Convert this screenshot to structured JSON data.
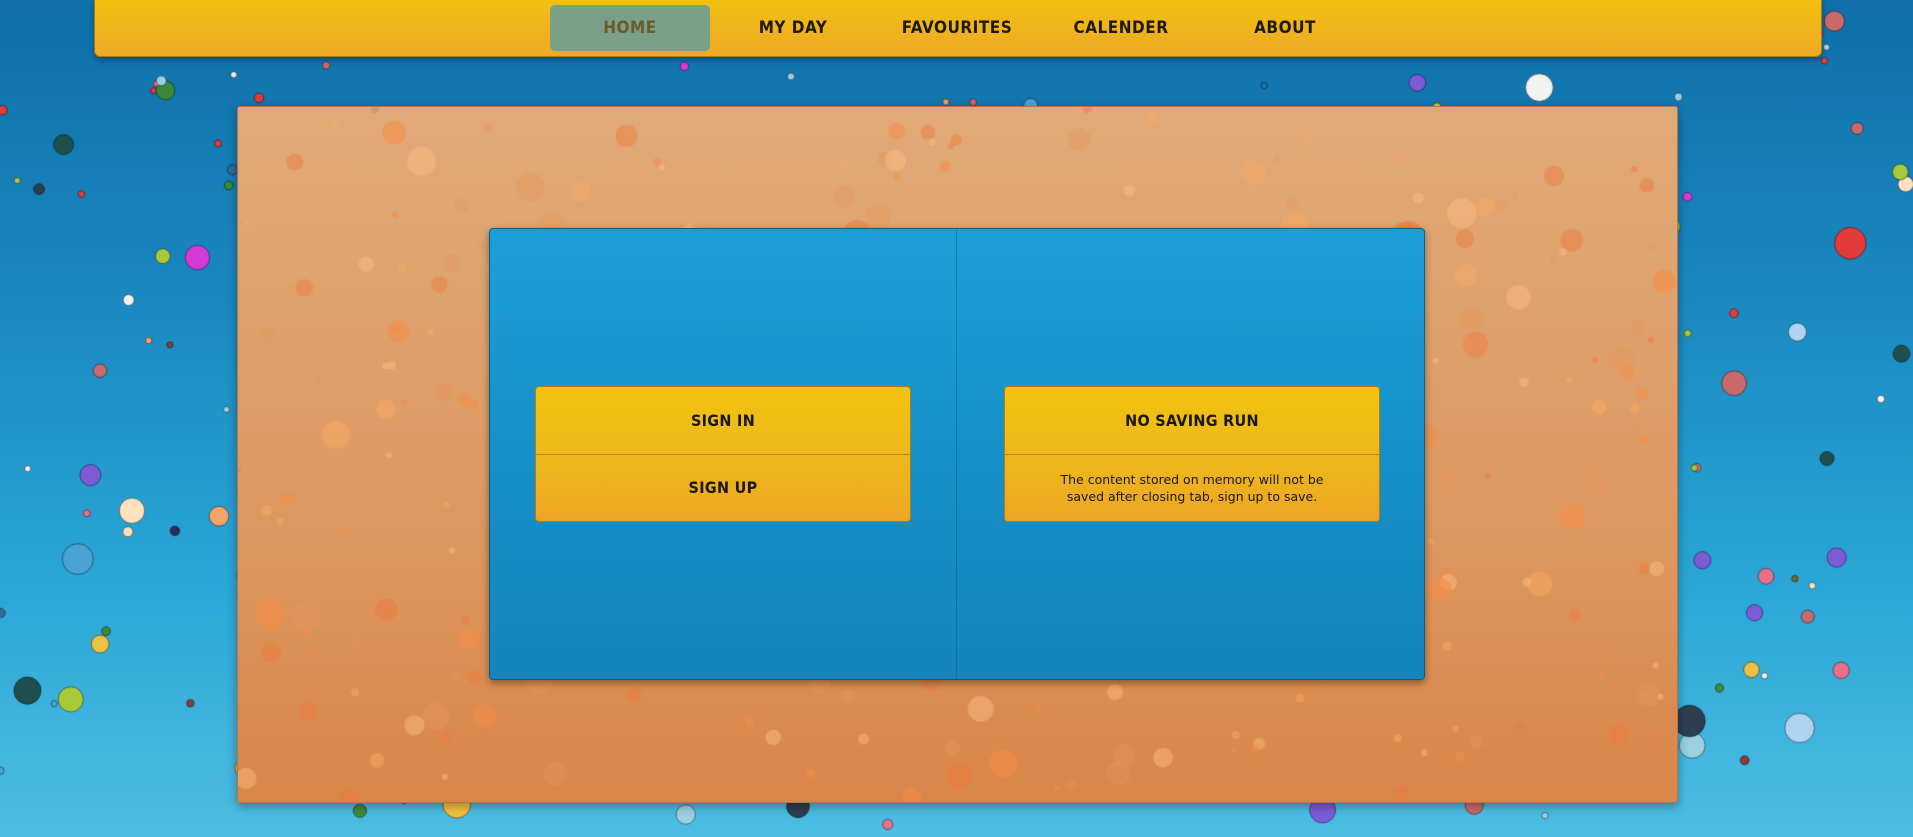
{
  "nav": {
    "items": [
      {
        "label": "HOME",
        "active": true
      },
      {
        "label": "MY DAY",
        "active": false
      },
      {
        "label": "FAVOURITES",
        "active": false
      },
      {
        "label": "CALENDER",
        "active": false
      },
      {
        "label": "ABOUT",
        "active": false
      }
    ]
  },
  "left_panel": {
    "sign_in_label": "SIGN IN",
    "sign_up_label": "SIGN UP"
  },
  "right_panel": {
    "no_saving_label": "NO SAVING RUN",
    "info_text": "The content stored on memory will not be saved after closing tab, sign up to save."
  },
  "colors": {
    "nav_bg": "#f2c00f",
    "nav_active": "#7ba08a",
    "card_bg": "#dd9a62",
    "panel_bg": "#1a96cf",
    "button_bg": "#f0b81a",
    "page_bg": "#1a88c0"
  }
}
